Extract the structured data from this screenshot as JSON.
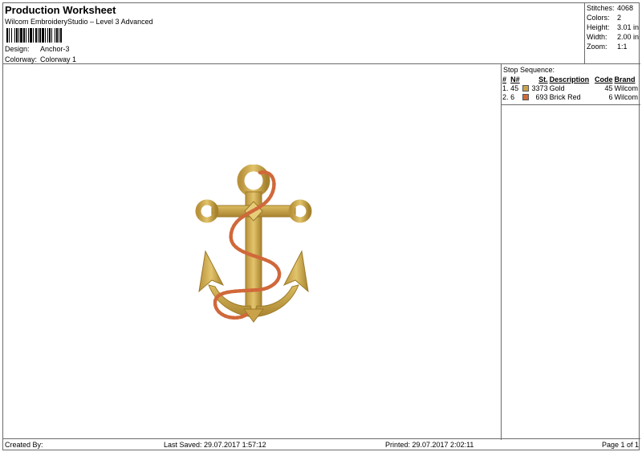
{
  "header": {
    "title": "Production Worksheet",
    "subtitle": "Wilcom EmbroideryStudio – Level 3 Advanced",
    "design_label": "Design:",
    "design_value": "Anchor-3",
    "colorway_label": "Colorway:",
    "colorway_value": "Colorway 1"
  },
  "stats": {
    "stitches_label": "Stitches:",
    "stitches_value": "4068",
    "colors_label": "Colors:",
    "colors_value": "2",
    "height_label": "Height:",
    "height_value": "3.01 in",
    "width_label": "Width:",
    "width_value": "2.00 in",
    "zoom_label": "Zoom:",
    "zoom_value": "1:1"
  },
  "stop_sequence": {
    "title": "Stop Sequence:",
    "columns": [
      "#",
      "N#",
      "St.",
      "Description",
      "Code",
      "Brand"
    ],
    "rows": [
      {
        "index": "1.",
        "n": "45",
        "color": "#c9a24a",
        "st": "3373",
        "description": "Gold",
        "code": "45",
        "brand": "Wilcom"
      },
      {
        "index": "2.",
        "n": "6",
        "color": "#d0683a",
        "st": "693",
        "description": "Brick Red",
        "code": "6",
        "brand": "Wilcom"
      }
    ]
  },
  "footer": {
    "created_by": "Created By:",
    "last_saved": "Last Saved: 29.07.2017 1:57:12",
    "printed": "Printed: 29.07.2017 2:02:11",
    "page": "Page 1 of 1"
  },
  "colors": {
    "gold": "#c9a24a",
    "gold_dark": "#9c7a28",
    "brick_red": "#d0683a"
  }
}
